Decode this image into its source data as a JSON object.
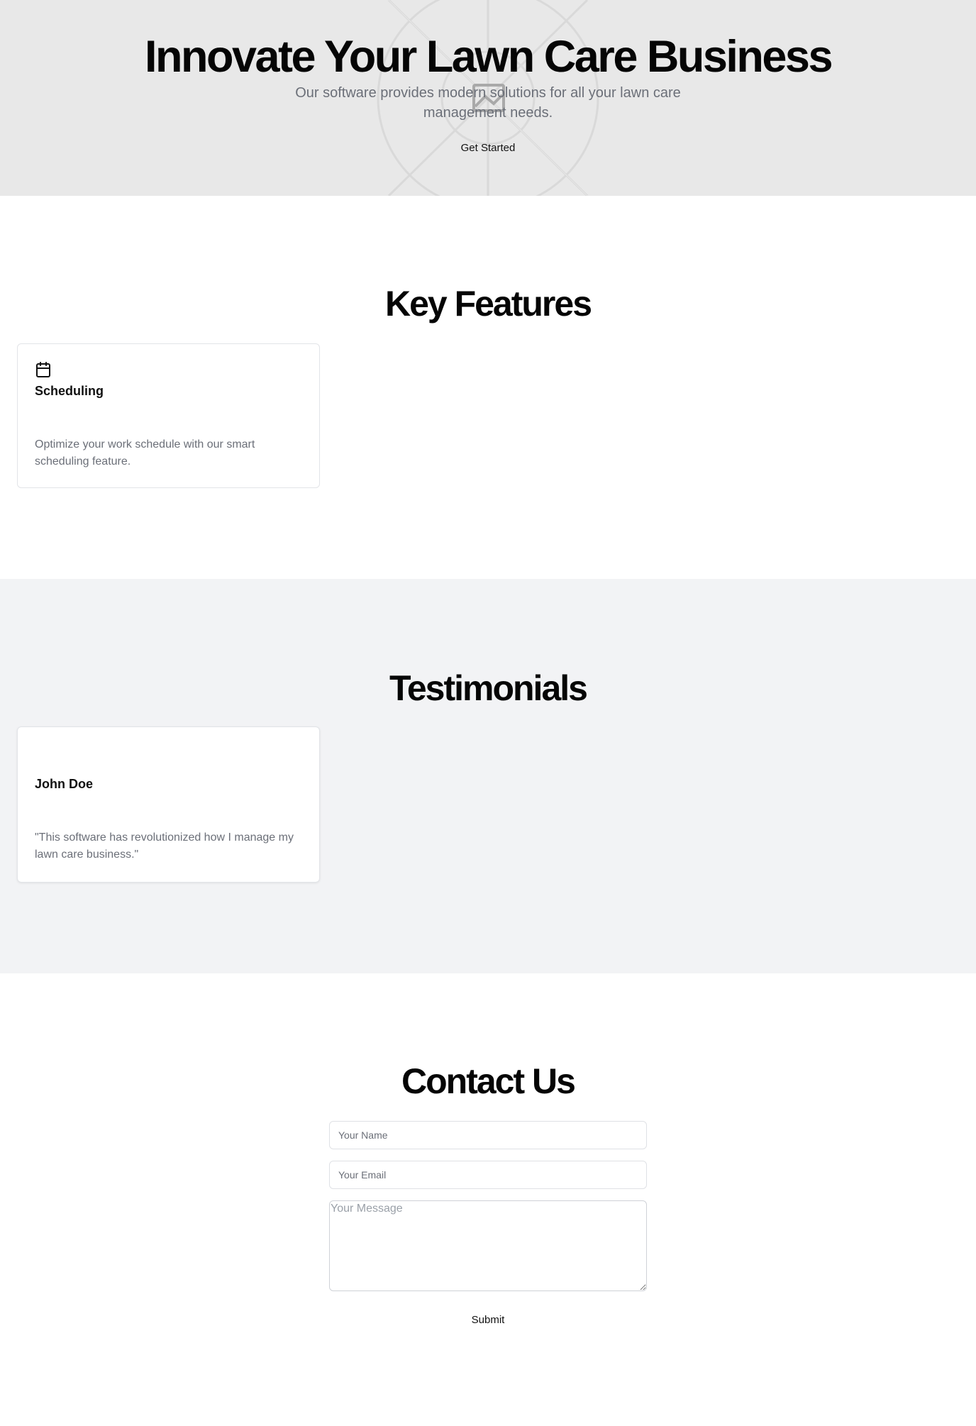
{
  "hero": {
    "title": "Innovate Your Lawn Care Business",
    "subtitle": "Our software provides modern solutions for all your lawn care management needs.",
    "cta_label": "Get Started",
    "background_icon": "image-placeholder-icon"
  },
  "features": {
    "title": "Key Features",
    "items": [
      {
        "icon": "calendar-icon",
        "title": "Scheduling",
        "description": "Optimize your work schedule with our smart scheduling feature."
      }
    ]
  },
  "testimonials": {
    "title": "Testimonials",
    "items": [
      {
        "name": "John Doe",
        "quote": "\"This software has revolutionized how I manage my lawn care business.\""
      }
    ]
  },
  "contact": {
    "title": "Contact Us",
    "name_placeholder": "Your Name",
    "email_placeholder": "Your Email",
    "message_placeholder": "Your Message",
    "submit_label": "Submit"
  },
  "colors": {
    "hero_bg": "#e8e8e8",
    "testimonials_bg": "#f2f3f5",
    "muted_text": "#6b6f78"
  }
}
